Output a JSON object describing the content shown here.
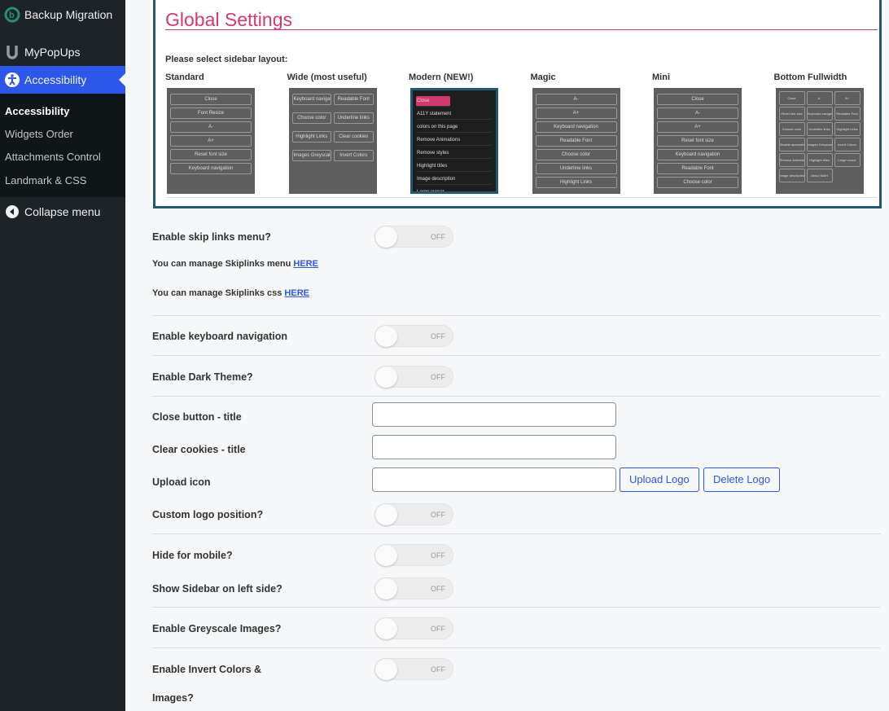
{
  "sidebar": {
    "items": [
      {
        "label": "Backup Migration",
        "icon": "backup-migration-icon"
      },
      {
        "label": "MyPopUps",
        "icon": "mypopups-icon"
      },
      {
        "label": "Accessibility",
        "icon": "accessibility-icon"
      }
    ],
    "submenu": [
      "Accessibility",
      "Widgets Order",
      "Attachments Control",
      "Landmark & CSS"
    ],
    "collapse": "Collapse menu"
  },
  "panel": {
    "title": "Global Settings",
    "select_label": "Please select sidebar layout:",
    "layouts": [
      {
        "name": "Standard",
        "items": [
          "Close",
          "Font Resize",
          "A-",
          "A+",
          "Reset font size",
          "Keyboard navigation"
        ]
      },
      {
        "name": "Wide (most useful)",
        "items": [
          "Keyboard navigation",
          "Readable Font",
          "Choose color",
          "Underline links",
          "Highlight Links",
          "Clear cookies",
          "Images Greyscale",
          "Invert Colors"
        ]
      },
      {
        "name": "Modern (NEW!)",
        "items": [
          "Close",
          "A11Y statement",
          "colors on this page",
          "Remove Animations",
          "Remove styles",
          "Highlight titles",
          "Image description",
          "Large cursor"
        ]
      },
      {
        "name": "Magic",
        "items": [
          "A-",
          "A+",
          "Keyboard navigation",
          "Readable Font",
          "Choose color",
          "Underline links",
          "Highlight Links"
        ]
      },
      {
        "name": "Mini",
        "items": [
          "Close",
          "A-",
          "A+",
          "Reset font size",
          "Keyboard navigation",
          "Readable Font",
          "Choose color"
        ]
      },
      {
        "name": "Bottom Fullwidth",
        "items": [
          "Close",
          "A-",
          "A+",
          "Reset font size",
          "Keyboard navigation",
          "Readable Font",
          "Choose color",
          "Underline links",
          "Highlight Links",
          "Disable accessibility",
          "Images Greyscale",
          "Invert Colors",
          "Remove Animations",
          "Highlight titles",
          "Large cursor",
          "Image description",
          "About WAH"
        ]
      }
    ]
  },
  "settings": {
    "skip_links": "Enable skip links menu?",
    "skip_menu_note": "You can manage Skiplinks menu ",
    "skip_css_note": "You can manage Skiplinks css ",
    "here": "HERE",
    "keyboard_nav": "Enable keyboard navigation",
    "dark_theme": "Enable Dark Theme?",
    "close_title": "Close button - title",
    "clear_cookies_title": "Clear cookies - title",
    "upload_icon": "Upload icon",
    "upload_logo": "Upload Logo",
    "delete_logo": "Delete Logo",
    "logo_position": "Custom logo position?",
    "hide_mobile": "Hide for mobile?",
    "sidebar_left": "Show Sidebar on left side?",
    "greyscale": "Enable Greyscale Images?",
    "invert_1": "Enable Invert Colors &",
    "invert_2": "Images?",
    "off": "OFF"
  },
  "colors": {
    "accent": "#2c57e8",
    "title": "#d2396f",
    "panel_border": "#1f5a6c"
  }
}
